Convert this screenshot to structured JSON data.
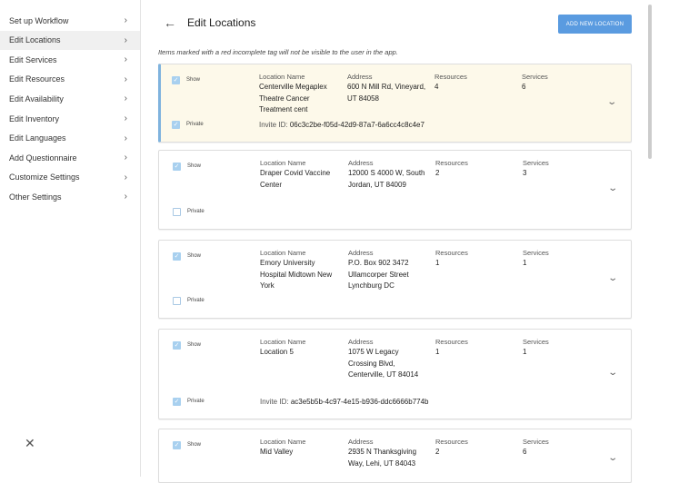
{
  "sidebar": {
    "items": [
      {
        "label": "Set up Workflow"
      },
      {
        "label": "Edit Locations"
      },
      {
        "label": "Edit Services"
      },
      {
        "label": "Edit Resources"
      },
      {
        "label": "Edit Availability"
      },
      {
        "label": "Edit Inventory"
      },
      {
        "label": "Edit Languages"
      },
      {
        "label": "Add Questionnaire"
      },
      {
        "label": "Customize Settings"
      },
      {
        "label": "Other Settings"
      }
    ]
  },
  "header": {
    "title": "Edit Locations",
    "add_button": "ADD NEW LOCATION"
  },
  "note": "Items marked with a red incomplete tag will not be visible to the user in the app.",
  "labels": {
    "show": "Show",
    "private": "Private",
    "location_name": "Location Name",
    "address": "Address",
    "resources": "Resources",
    "services": "Services",
    "invite": "Invite ID:"
  },
  "locations": [
    {
      "name": "Centerville Megaplex Theatre Cancer Treatment cent",
      "address": "600 N Mill Rd, Vineyard, UT 84058",
      "resources": "4",
      "services": "6",
      "show": true,
      "private": true,
      "invite_id": "06c3c2be-f05d-42d9-87a7-6a6cc4c8c4e7"
    },
    {
      "name": "Draper Covid Vaccine Center",
      "address": "12000 S 4000 W, South Jordan, UT 84009",
      "resources": "2",
      "services": "3",
      "show": true,
      "private": false
    },
    {
      "name": "Emory University Hospital Midtown New York",
      "address": "P.O. Box 902 3472 Ullamcorper Street Lynchburg DC",
      "resources": "1",
      "services": "1",
      "show": true,
      "private": false
    },
    {
      "name": "Location 5",
      "address": "1075 W Legacy Crossing Blvd, Centerville, UT 84014",
      "resources": "1",
      "services": "1",
      "show": true,
      "private": true,
      "invite_id": "ac3e5b5b-4c97-4e15-b936-ddc6666b774b"
    },
    {
      "name": "Mid Valley",
      "address": "2935 N Thanksgiving Way, Lehi, UT 84043",
      "resources": "2",
      "services": "6",
      "show": true
    }
  ]
}
